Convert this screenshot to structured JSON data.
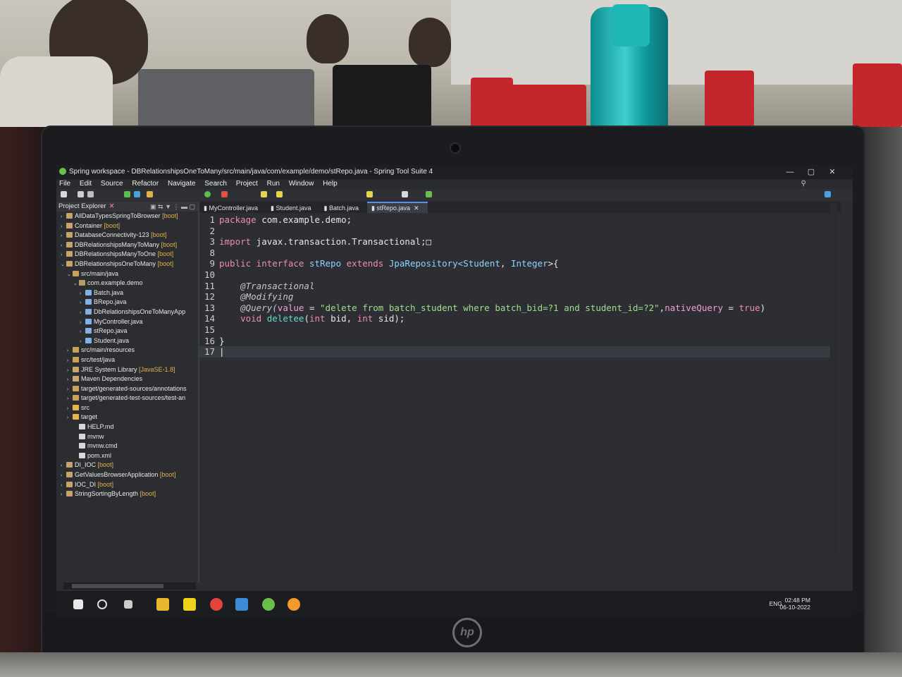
{
  "window": {
    "title": "Spring workspace - DBRelationshipsOneToMany/src/main/java/com/example/demo/stRepo.java - Spring Tool Suite 4",
    "controls": [
      "—",
      "▢",
      "✕"
    ]
  },
  "menu": [
    "File",
    "Edit",
    "Source",
    "Refactor",
    "Navigate",
    "Search",
    "Project",
    "Run",
    "Window",
    "Help"
  ],
  "explorer": {
    "title": "Project Explorer",
    "items": [
      {
        "label": "AllDataTypesSpringToBrowser",
        "tag": "[boot]"
      },
      {
        "label": "Container",
        "tag": "[boot]"
      },
      {
        "label": "DatabaseConnectivity-123",
        "tag": "[boot]"
      },
      {
        "label": "DBRelationshipsManyToMany",
        "tag": "[boot]"
      },
      {
        "label": "DBRelationshipsManyToOne",
        "tag": "[boot]"
      },
      {
        "label": "DBRelationshipsOneToMany",
        "tag": "[boot]"
      },
      {
        "label": "src/main/java",
        "tag": ""
      },
      {
        "label": "com.example.demo",
        "tag": ""
      },
      {
        "label": "Batch.java",
        "tag": ""
      },
      {
        "label": "BRepo.java",
        "tag": ""
      },
      {
        "label": "DbRelationshipsOneToManyApp",
        "tag": ""
      },
      {
        "label": "MyController.java",
        "tag": ""
      },
      {
        "label": "stRepo.java",
        "tag": ""
      },
      {
        "label": "Student.java",
        "tag": ""
      },
      {
        "label": "src/main/resources",
        "tag": ""
      },
      {
        "label": "src/test/java",
        "tag": ""
      },
      {
        "label": "JRE System Library",
        "tag": "[JavaSE-1.8]"
      },
      {
        "label": "Maven Dependencies",
        "tag": ""
      },
      {
        "label": "target/generated-sources/annotations",
        "tag": ""
      },
      {
        "label": "target/generated-test-sources/test-an",
        "tag": ""
      },
      {
        "label": "src",
        "tag": ""
      },
      {
        "label": "target",
        "tag": ""
      },
      {
        "label": "HELP.md",
        "tag": ""
      },
      {
        "label": "mvnw",
        "tag": ""
      },
      {
        "label": "mvnw.cmd",
        "tag": ""
      },
      {
        "label": "pom.xml",
        "tag": ""
      },
      {
        "label": "DI_IOC",
        "tag": "[boot]"
      },
      {
        "label": "GetValuesBrowserApplication",
        "tag": "[boot]"
      },
      {
        "label": "IOC_DI",
        "tag": "[boot]"
      },
      {
        "label": "StringSortingByLength",
        "tag": "[boot]"
      }
    ]
  },
  "tabs": [
    {
      "label": "MyController.java",
      "active": false
    },
    {
      "label": "Student.java",
      "active": false
    },
    {
      "label": "Batch.java",
      "active": false
    },
    {
      "label": "stRepo.java",
      "active": true
    }
  ],
  "code": {
    "line_numbers": [
      "1",
      "2",
      "3",
      "8",
      "9",
      "10",
      "11",
      "12",
      "13",
      "14",
      "15",
      "16",
      "17"
    ],
    "l1_kw": "package",
    "l1_rest": " com.example.demo;",
    "l3_kw": "import",
    "l3_rest": " javax.transaction.Transactional;",
    "l9_public": "public",
    "l9_interface": " interface ",
    "l9_name": "stRepo",
    "l9_extends": " extends ",
    "l9_type": "JpaRepository<",
    "l9_student": "Student",
    "l9_comma": ", ",
    "l9_integer": "Integer",
    "l9_end": ">{",
    "l11": "@Transactional",
    "l12": "@Modifying",
    "l13_ann": "@Query(",
    "l13_attr": "value",
    "l13_eq": " = ",
    "l13_str": "\"delete from batch_student where batch_bid=?1 and student_id=?2\"",
    "l13_comma": ",",
    "l13_attr2": "nativeQuery",
    "l13_eq2": " = ",
    "l13_true": "true",
    "l13_close": ")",
    "l14_void": "void ",
    "l14_fn": "deletee",
    "l14_open": "(",
    "l14_int1": "int",
    "l14_bid": " bid, ",
    "l14_int2": "int",
    "l14_sid": " sid);",
    "l16": "}"
  },
  "taskbar": {
    "lang": "ENG",
    "time": "02:48 PM",
    "date": "06-10-2022"
  }
}
